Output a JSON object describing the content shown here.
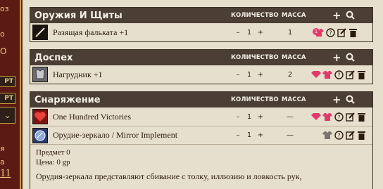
{
  "sidebar": {
    "text1": "оз",
    "text2": "о",
    "text3": "О",
    "badge1": "РТ",
    "badge2": "РТ",
    "select_glyph": "⌄",
    "text4": "я",
    "text5": "а",
    "big_number": "11"
  },
  "sections": [
    {
      "title": "Оружия И Щиты",
      "qty_header": "КОЛИЧЕСТВО",
      "mass_header": "МАССА",
      "items": [
        {
          "name": "Разящая фальката +1",
          "qty": "1",
          "mass": "1",
          "badge": "1",
          "icon": "sword-icon"
        }
      ]
    },
    {
      "title": "Доспех",
      "qty_header": "КОЛИЧЕСТВО",
      "mass_header": "МАССА",
      "items": [
        {
          "name": "Нагрудник +1",
          "qty": "1",
          "mass": "2",
          "icon": "armor-icon"
        }
      ]
    },
    {
      "title": "Снаряжение",
      "qty_header": "КОЛИЧЕСТВО",
      "mass_header": "МАССА",
      "items": [
        {
          "name": "One Hundred Victories",
          "qty": "1",
          "mass": "—",
          "icon": "heart-icon"
        },
        {
          "name": "Орудие-зеркало / Mirror Implement",
          "qty": "1",
          "mass": "—",
          "icon": "mirror-icon"
        }
      ],
      "detail": {
        "subject_line": "Предмет 0",
        "price_line": "Цена: 0 gp",
        "description": "Орудия-зеркала представляют сбивание с толку, иллюзию и ловкость рук,"
      }
    }
  ],
  "controls": {
    "minus": "–",
    "plus": "+",
    "add": "+",
    "search": "search"
  },
  "colors": {
    "header_bg": "#4a3e35",
    "panel_bg": "#e7dfcd",
    "accent_pink": "#e03a6a",
    "sidebar_bg": "#5c1a14",
    "gold": "#c89a3e"
  }
}
